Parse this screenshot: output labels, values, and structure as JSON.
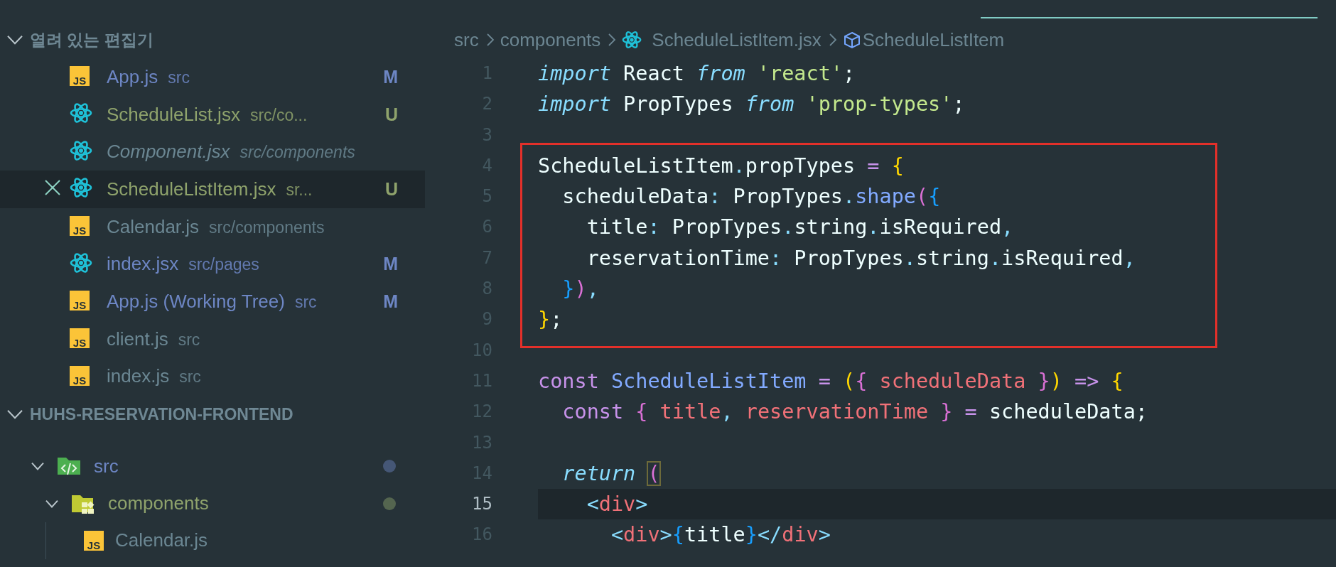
{
  "sidebar": {
    "open_editors": {
      "title": "열려 있는 편집기",
      "expanded": true,
      "items": [
        {
          "name": "App.js",
          "path": "src",
          "kind": "js",
          "label": "JS",
          "color": "#6d86c4",
          "badge": "M",
          "preview": false,
          "selected": false
        },
        {
          "name": "ScheduleList.jsx",
          "path": "src/co...",
          "kind": "react",
          "color": "#8fa36c",
          "badge": "U",
          "preview": false,
          "selected": false
        },
        {
          "name": "Component.jsx",
          "path": "src/components",
          "kind": "react",
          "color": "#6b8793",
          "preview": true,
          "selected": false
        },
        {
          "name": "ScheduleListItem.jsx",
          "path": "sr...",
          "kind": "react",
          "color": "#8fa36c",
          "badge": "U",
          "preview": false,
          "selected": true
        },
        {
          "name": "Calendar.js",
          "path": "src/components",
          "kind": "js",
          "label": "JS",
          "color": "#6b8793",
          "preview": false,
          "selected": false
        },
        {
          "name": "index.jsx",
          "path": "src/pages",
          "kind": "react",
          "color": "#6d86c4",
          "badge": "M",
          "preview": false,
          "selected": false
        },
        {
          "name": "App.js (Working Tree)",
          "path": "src",
          "kind": "js",
          "label": "JS",
          "color": "#6d86c4",
          "badge": "M",
          "preview": false,
          "selected": false
        },
        {
          "name": "client.js",
          "path": "src",
          "kind": "js",
          "label": "JS",
          "color": "#6b8793",
          "preview": false,
          "selected": false
        },
        {
          "name": "index.js",
          "path": "src",
          "kind": "js",
          "label": "JS",
          "color": "#6b8793",
          "preview": false,
          "selected": false
        }
      ]
    },
    "explorer": {
      "title": "HUHS-RESERVATION-FRONTEND",
      "expanded": true,
      "children": [
        {
          "name": "src",
          "kind": "folder-src",
          "expanded": true,
          "color": "#6d86c4",
          "changed": true,
          "children": [
            {
              "name": "components",
              "kind": "folder-components",
              "expanded": true,
              "color": "#8fa36c",
              "changed": true,
              "children": [
                {
                  "name": "Calendar.js",
                  "kind": "js",
                  "label": "JS",
                  "color": "#6b8793",
                  "changed": false
                }
              ]
            }
          ]
        }
      ]
    }
  },
  "editor": {
    "breadcrumbs": [
      {
        "text": "src",
        "kind": "folder"
      },
      {
        "text": "components",
        "kind": "folder"
      },
      {
        "text": "ScheduleListItem.jsx",
        "kind": "react"
      },
      {
        "text": "ScheduleListItem",
        "kind": "symbol"
      }
    ],
    "lines": [
      {
        "number": "1",
        "current": false,
        "boxed": false,
        "tokens": [
          {
            "text": "import ",
            "kind": "kw"
          },
          {
            "text": "React ",
            "kind": "plain"
          },
          {
            "text": "from ",
            "kind": "kw"
          },
          {
            "text": "'react'",
            "kind": "str"
          },
          {
            "text": ";",
            "kind": "plain"
          }
        ]
      },
      {
        "number": "2",
        "current": false,
        "boxed": false,
        "tokens": [
          {
            "text": "import ",
            "kind": "kw"
          },
          {
            "text": "PropTypes ",
            "kind": "plain"
          },
          {
            "text": "from ",
            "kind": "kw"
          },
          {
            "text": "'prop-types'",
            "kind": "str"
          },
          {
            "text": ";",
            "kind": "plain"
          }
        ]
      },
      {
        "number": "3",
        "current": false,
        "boxed": false
      },
      {
        "number": "4",
        "current": false,
        "boxed": true,
        "tokens": [
          {
            "text": "ScheduleListItem",
            "kind": "plain"
          },
          {
            "text": ".",
            "kind": "punct"
          },
          {
            "text": "propTypes ",
            "kind": "plain"
          },
          {
            "text": "= ",
            "kind": "op"
          },
          {
            "text": "{",
            "kind": "b1"
          }
        ]
      },
      {
        "number": "5",
        "current": false,
        "boxed": true,
        "tokens": [
          {
            "text": "  scheduleData",
            "kind": "plain"
          },
          {
            "text": ":",
            "kind": "punct"
          },
          {
            "text": " PropTypes",
            "kind": "plain"
          },
          {
            "text": ".",
            "kind": "punct"
          },
          {
            "text": "shape",
            "kind": "func"
          },
          {
            "text": "(",
            "kind": "b2"
          },
          {
            "text": "{",
            "kind": "b3"
          }
        ]
      },
      {
        "number": "6",
        "current": false,
        "boxed": true,
        "tokens": [
          {
            "text": "    title",
            "kind": "plain"
          },
          {
            "text": ":",
            "kind": "punct"
          },
          {
            "text": " PropTypes",
            "kind": "plain"
          },
          {
            "text": ".",
            "kind": "punct"
          },
          {
            "text": "string",
            "kind": "plain"
          },
          {
            "text": ".",
            "kind": "punct"
          },
          {
            "text": "isRequired",
            "kind": "plain"
          },
          {
            "text": ",",
            "kind": "punct"
          }
        ]
      },
      {
        "number": "7",
        "current": false,
        "boxed": true,
        "tokens": [
          {
            "text": "    reservationTime",
            "kind": "plain"
          },
          {
            "text": ":",
            "kind": "punct"
          },
          {
            "text": " PropTypes",
            "kind": "plain"
          },
          {
            "text": ".",
            "kind": "punct"
          },
          {
            "text": "string",
            "kind": "plain"
          },
          {
            "text": ".",
            "kind": "punct"
          },
          {
            "text": "isRequired",
            "kind": "plain"
          },
          {
            "text": ",",
            "kind": "punct"
          }
        ]
      },
      {
        "number": "8",
        "current": false,
        "boxed": true,
        "tokens": [
          {
            "text": "  }",
            "kind": "b3"
          },
          {
            "text": ")",
            "kind": "b2"
          },
          {
            "text": ",",
            "kind": "punct"
          }
        ]
      },
      {
        "number": "9",
        "current": false,
        "boxed": true,
        "tokens": [
          {
            "text": "}",
            "kind": "b1"
          },
          {
            "text": ";",
            "kind": "plain"
          }
        ]
      },
      {
        "number": "10",
        "current": false,
        "boxed": false
      },
      {
        "number": "11",
        "current": false,
        "boxed": false,
        "tokens": [
          {
            "text": "const ",
            "kind": "decl"
          },
          {
            "text": "ScheduleListItem ",
            "kind": "func"
          },
          {
            "text": "= ",
            "kind": "op"
          },
          {
            "text": "(",
            "kind": "b1"
          },
          {
            "text": "{ ",
            "kind": "b2"
          },
          {
            "text": "scheduleData ",
            "kind": "var"
          },
          {
            "text": "}",
            "kind": "b2"
          },
          {
            "text": ") ",
            "kind": "b1"
          },
          {
            "text": "=> ",
            "kind": "op"
          },
          {
            "text": "{",
            "kind": "b1"
          }
        ]
      },
      {
        "number": "12",
        "current": false,
        "boxed": false,
        "tokens": [
          {
            "text": "  const ",
            "kind": "decl"
          },
          {
            "text": "{ ",
            "kind": "b2"
          },
          {
            "text": "title",
            "kind": "var"
          },
          {
            "text": ", ",
            "kind": "punct"
          },
          {
            "text": "reservationTime ",
            "kind": "var"
          },
          {
            "text": "} ",
            "kind": "b2"
          },
          {
            "text": "= ",
            "kind": "op"
          },
          {
            "text": "scheduleData;",
            "kind": "plain"
          }
        ]
      },
      {
        "number": "13",
        "current": false,
        "boxed": false
      },
      {
        "number": "14",
        "current": false,
        "boxed": false,
        "tokens": [
          {
            "text": "  return ",
            "kind": "kw"
          },
          {
            "text": "(",
            "kind": "b2-match"
          }
        ]
      },
      {
        "number": "15",
        "current": true,
        "boxed": false,
        "tokens": [
          {
            "text": "    <",
            "kind": "tagp"
          },
          {
            "text": "div",
            "kind": "tag"
          },
          {
            "text": ">",
            "kind": "tagp"
          }
        ]
      },
      {
        "number": "16",
        "current": false,
        "boxed": false,
        "tokens": [
          {
            "text": "      <",
            "kind": "tagp"
          },
          {
            "text": "div",
            "kind": "tag"
          },
          {
            "text": ">",
            "kind": "tagp"
          },
          {
            "text": "{",
            "kind": "b3"
          },
          {
            "text": "title",
            "kind": "plain"
          },
          {
            "text": "}",
            "kind": "b3"
          },
          {
            "text": "</",
            "kind": "tagp"
          },
          {
            "text": "div",
            "kind": "tag"
          },
          {
            "text": ">",
            "kind": "tagp"
          }
        ]
      }
    ]
  }
}
